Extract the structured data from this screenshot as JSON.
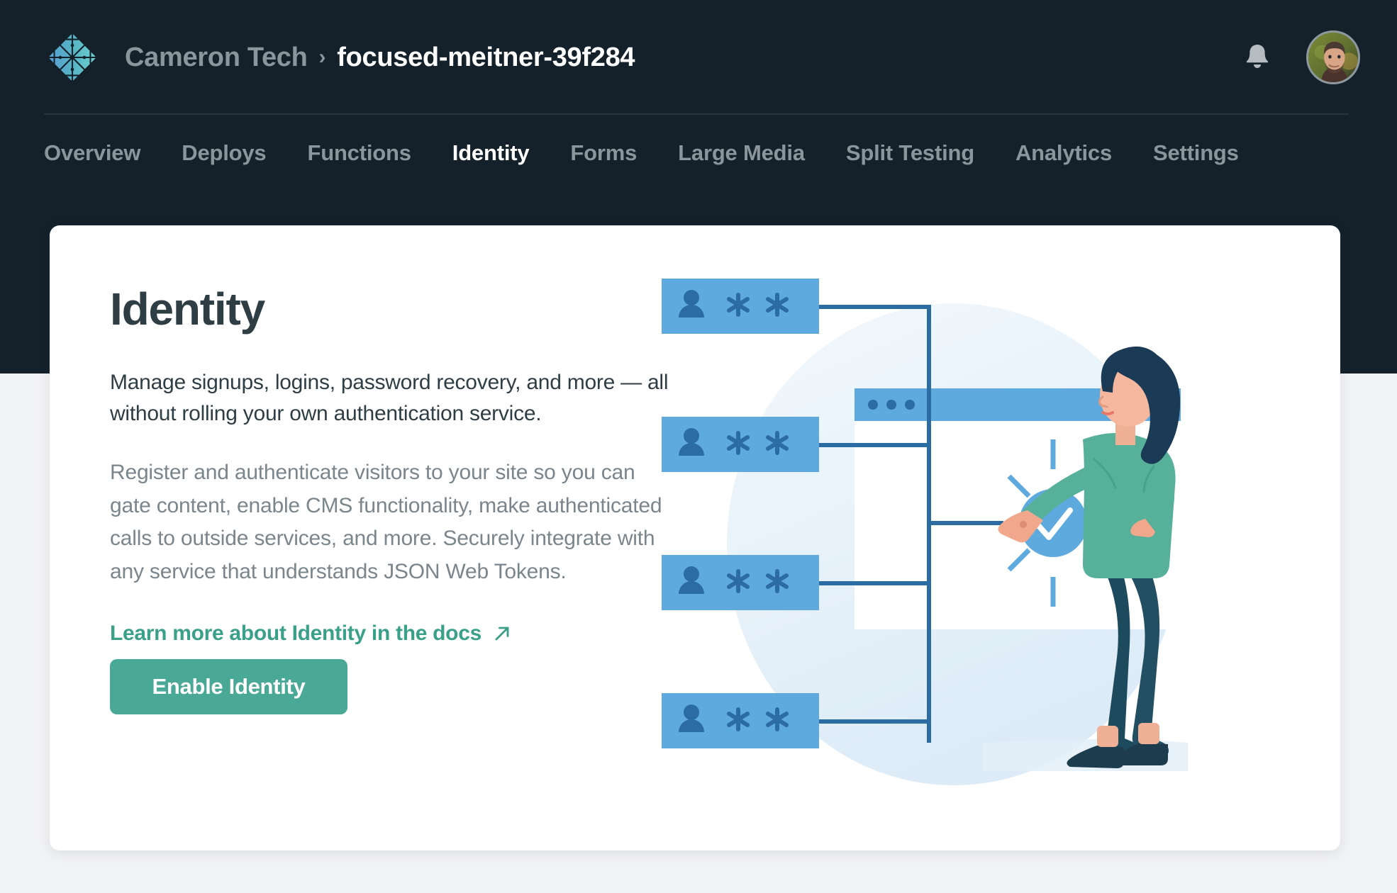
{
  "colors": {
    "chrome_bg": "#14212b",
    "page_bg": "#f2f3f5",
    "card_bg": "#ffffff",
    "accent_teal": "#4aa896",
    "link_teal": "#3aa088",
    "heading": "#2f3d45",
    "muted_text": "#7a858c",
    "nav_inactive": "#8a959c",
    "illustration_blue": "#5ea9dd",
    "illustration_blue_dark": "#2b6ca3"
  },
  "header": {
    "logo_icon": "netlify-diamond-logo",
    "breadcrumb": {
      "org": "Cameron Tech",
      "separator": "›",
      "site": "focused-meitner-39f284"
    },
    "notifications_icon": "bell-icon",
    "avatar_icon": "user-avatar"
  },
  "nav": {
    "items": [
      {
        "label": "Overview",
        "active": false
      },
      {
        "label": "Deploys",
        "active": false
      },
      {
        "label": "Functions",
        "active": false
      },
      {
        "label": "Identity",
        "active": true
      },
      {
        "label": "Forms",
        "active": false
      },
      {
        "label": "Large Media",
        "active": false
      },
      {
        "label": "Split Testing",
        "active": false
      },
      {
        "label": "Analytics",
        "active": false
      },
      {
        "label": "Settings",
        "active": false
      }
    ]
  },
  "main": {
    "title": "Identity",
    "lead": "Manage signups, logins, password recovery, and more — all without rolling your own authentication service.",
    "body": "Register and authenticate visitors to your site so you can gate content, enable CMS functionality, make authenticated calls to outside services, and more. Securely integrate with any service that understands JSON Web Tokens.",
    "docs_link_label": "Learn more about Identity in the docs",
    "docs_link_icon": "external-link-arrow-icon",
    "cta_label": "Enable Identity",
    "illustration": {
      "name": "identity-authentication-illustration",
      "credential_cards": 4,
      "credential_card_icons": [
        "person-icon",
        "asterisk-icon",
        "asterisk-icon"
      ],
      "browser_window_dots": 3,
      "badge_icon": "check-circle-icon",
      "figure": "woman-pointing-at-checkmark"
    }
  }
}
